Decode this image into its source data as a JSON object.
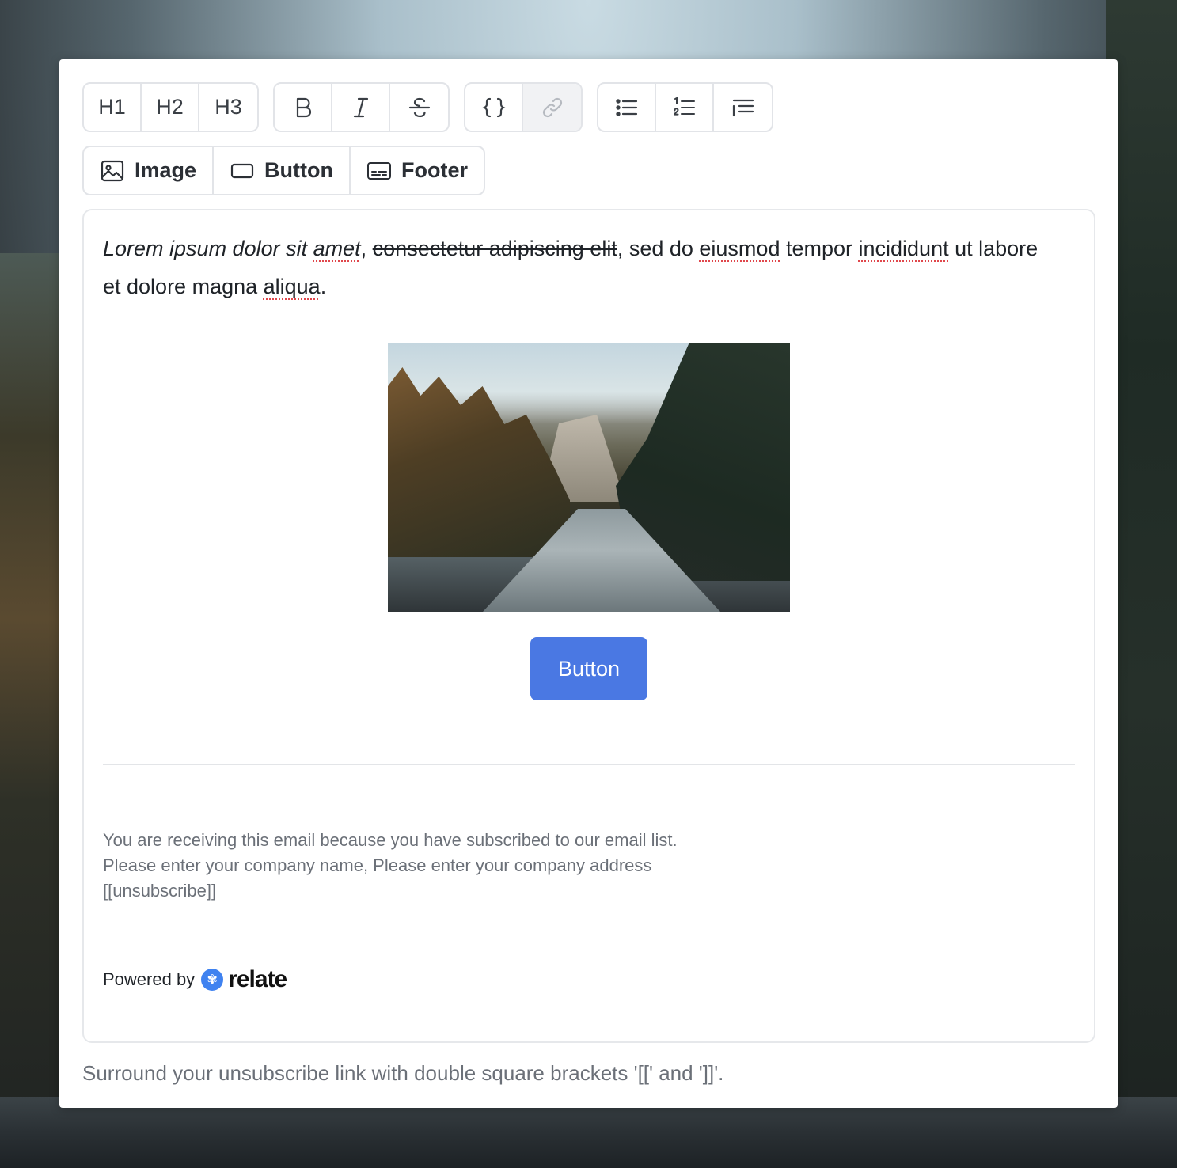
{
  "toolbar": {
    "headings": [
      "H1",
      "H2",
      "H3"
    ],
    "blocks": [
      {
        "icon": "image-icon",
        "label": "Image"
      },
      {
        "icon": "button-icon",
        "label": "Button"
      },
      {
        "icon": "footer-icon",
        "label": "Footer"
      }
    ]
  },
  "content": {
    "para_italic": "Lorem ipsum dolor sit ",
    "para_italic_spell": "amet",
    "para_comma": ", ",
    "para_strike": "consectetur adipiscing elit",
    "para_rest1": ", sed do ",
    "para_spell1": "eiusmod",
    "para_rest2": " tempor ",
    "para_spell2": "incididunt",
    "para_rest3": " ut labore et dolore magna ",
    "para_spell3": "aliqua",
    "para_end": ".",
    "button_label": "Button",
    "footer_line1": "You are receiving this email because you have subscribed to our email list.",
    "footer_line2": "Please enter your company name, Please enter your company address",
    "footer_line3": "[[unsubscribe]]",
    "powered_by": "Powered by",
    "brand_name": "relate"
  },
  "hint": "Surround your unsubscribe link with double square brackets '[[' and ']]'.",
  "colors": {
    "accent": "#4a78e3",
    "brand": "#3f82f0"
  }
}
